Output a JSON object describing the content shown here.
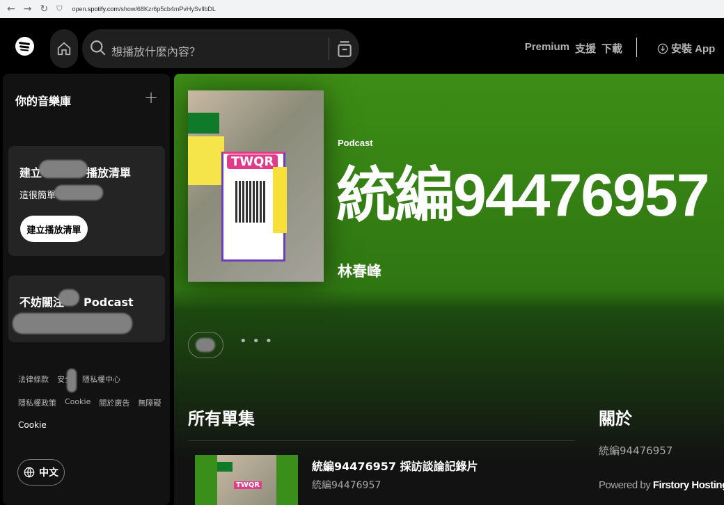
{
  "browser": {
    "url_prefix": "open.",
    "url_domain": "spotify.com",
    "url_path": "/show/68Kzr6p5cb4mPvHySvllbDL"
  },
  "topbar": {
    "search_placeholder": "想播放什麼內容？",
    "links": [
      "Premium",
      "支援",
      "下載"
    ],
    "install_label": "安裝 App"
  },
  "sidebar": {
    "library_title": "你的音樂庫",
    "card1": {
      "title_start": "建立",
      "title_end": "播放清單",
      "desc": "這很簡單",
      "button": "建立播放清單"
    },
    "card2": {
      "title_start": "不妨關注",
      "title_end": "Podcast"
    },
    "legal_row1": [
      "法律條款",
      "安全",
      "隱私權中心"
    ],
    "legal_row2": [
      "隱私權政策",
      "Cookie",
      "關於廣告",
      "無障礙"
    ],
    "legal_cookie": "Cookie",
    "language": "中文"
  },
  "show": {
    "kind": "Podcast",
    "title": "統編94476957",
    "author": "林春峰",
    "cover_label": "TWQR",
    "more": "• • •"
  },
  "episodes": {
    "section_title": "所有單集",
    "items": [
      {
        "title": "統編94476957 採訪談論記錄片",
        "subtitle": "統編94476957",
        "thumb_label": "TWQR"
      }
    ]
  },
  "about": {
    "title": "關於",
    "text": "統編94476957",
    "powered_prefix": "Powered by",
    "powered_brand": "Firstory Hosting"
  }
}
